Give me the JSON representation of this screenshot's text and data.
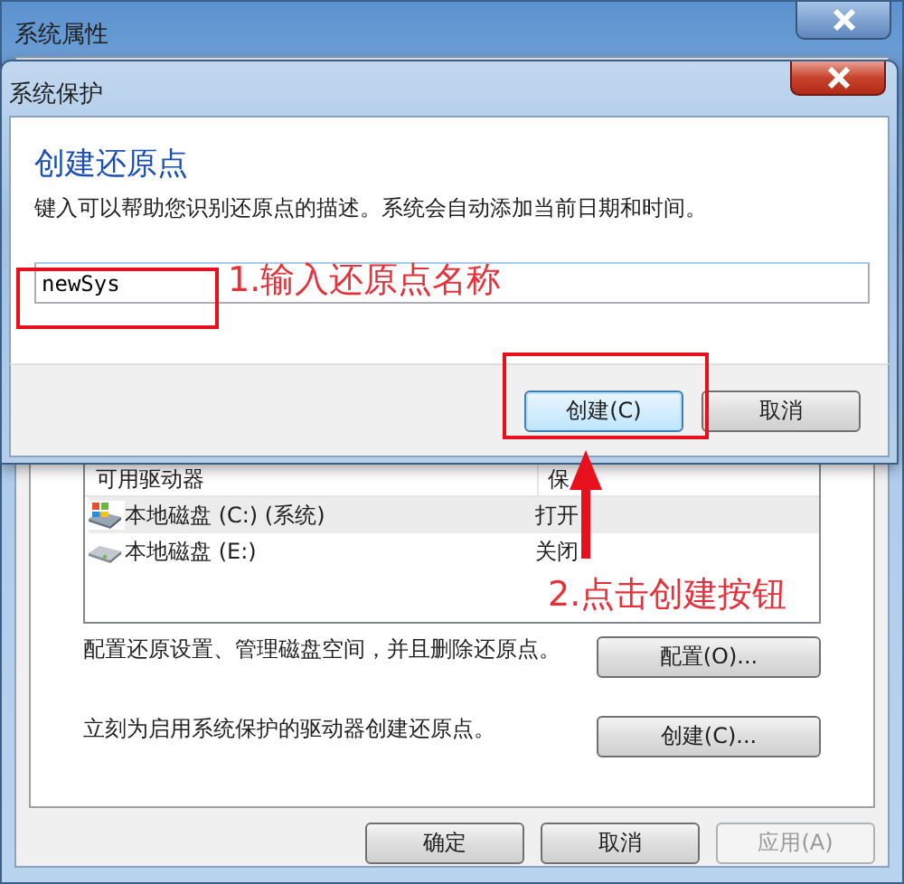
{
  "outer_window": {
    "title": "系统属性",
    "drives_list": {
      "columns": [
        "可用驱动器",
        "保"
      ],
      "rows": [
        {
          "name": "本地磁盘 (C:) (系统)",
          "protection": "打开",
          "kind": "system",
          "selected": true
        },
        {
          "name": "本地磁盘 (E:)",
          "protection": "关闭",
          "kind": "plain",
          "selected": false
        }
      ]
    },
    "configure": {
      "text": "配置还原设置、管理磁盘空间，并且删除还原点。",
      "button": "配置(O)..."
    },
    "create": {
      "text": "立刻为启用系统保护的驱动器创建还原点。",
      "button": "创建(C)..."
    },
    "buttons": [
      {
        "label": "确定",
        "disabled": false
      },
      {
        "label": "取消",
        "disabled": false
      },
      {
        "label": "应用(A)",
        "disabled": true
      }
    ]
  },
  "dialog": {
    "title": "系统保护",
    "heading": "创建还原点",
    "description": "键入可以帮助您识别还原点的描述。系统会自动添加当前日期和时间。",
    "input_value": "newSys",
    "buttons": [
      {
        "label": "创建(C)",
        "focused": true
      },
      {
        "label": "取消",
        "focused": false
      }
    ]
  },
  "annotations": [
    {
      "text": "1.输入还原点名称"
    },
    {
      "text": "2.点击创建按钮"
    }
  ]
}
